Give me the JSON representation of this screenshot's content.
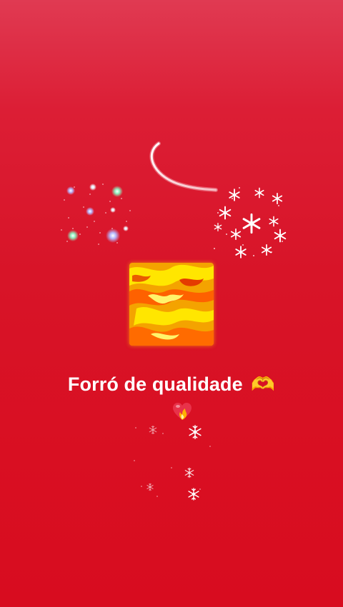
{
  "story": {
    "caption": "Forró de qualidade",
    "caption_emoji": "🫶",
    "caption_emoji_icon": "heart-hands-icon",
    "heart_emoji_icon": "heart-on-fire-icon",
    "background_color": "#d81428",
    "stickers": [
      "comet-sticker",
      "fireworks-sticker",
      "snowflakes-sticker",
      "fire-square-sticker",
      "falling-snowflakes-sticker"
    ]
  }
}
